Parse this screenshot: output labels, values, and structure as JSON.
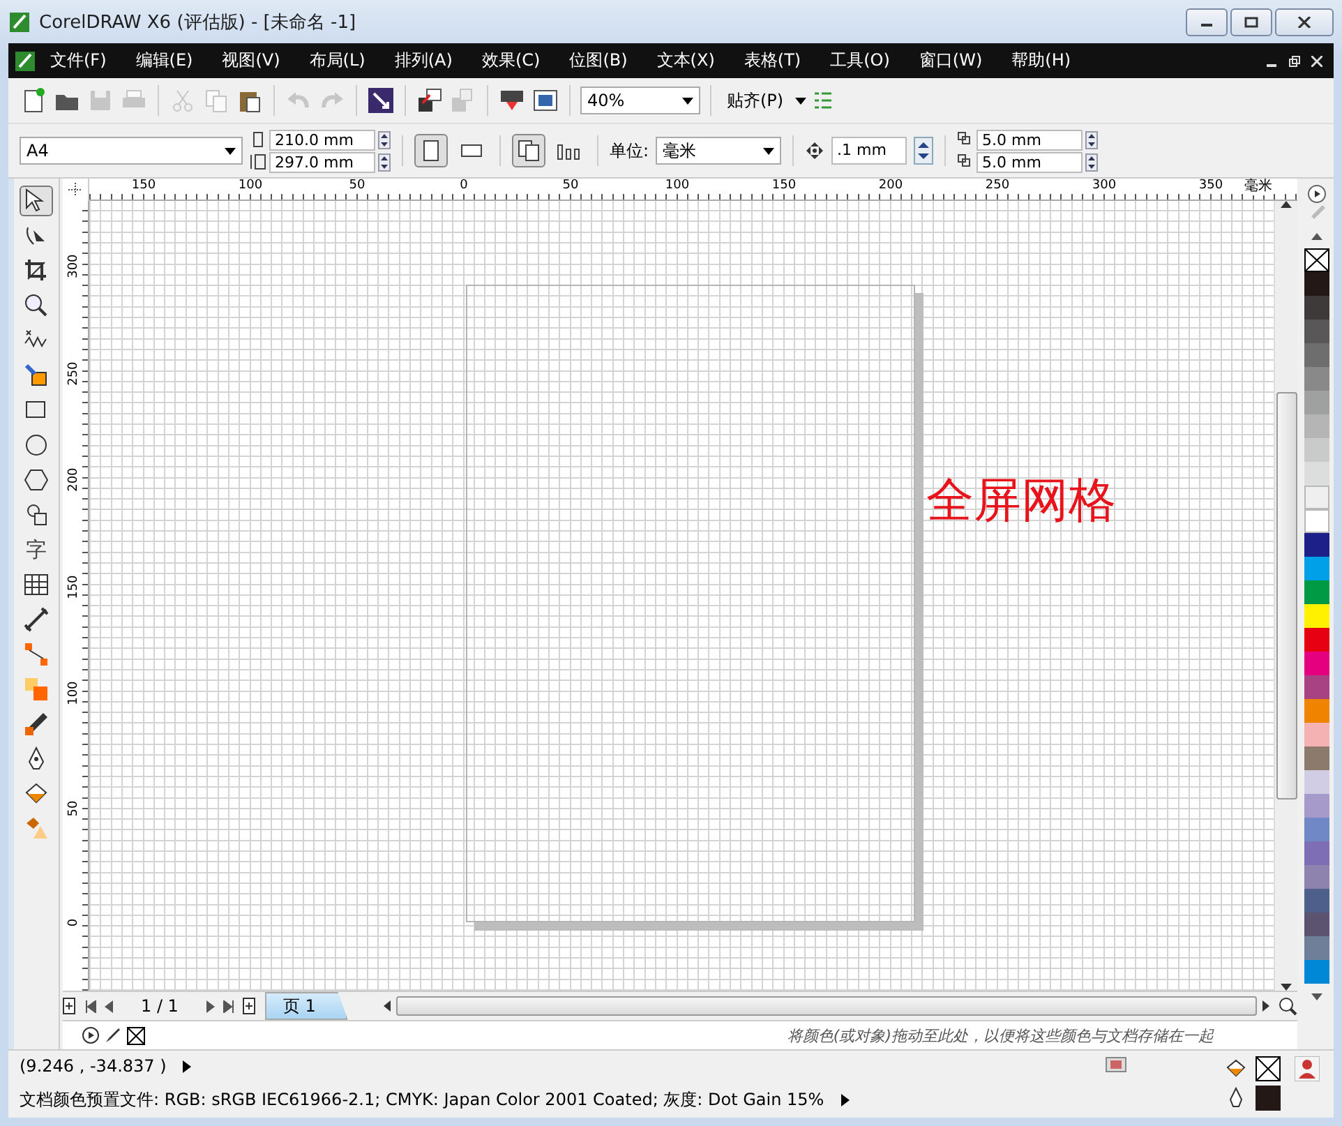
{
  "window": {
    "title": "CorelDRAW X6 (评估版) - [未命名 -1]"
  },
  "menu": [
    "文件(F)",
    "编辑(E)",
    "视图(V)",
    "布局(L)",
    "排列(A)",
    "效果(C)",
    "位图(B)",
    "文本(X)",
    "表格(T)",
    "工具(O)",
    "窗口(W)",
    "帮助(H)"
  ],
  "toolbar": {
    "buttons": [
      {
        "kind": "new",
        "disabled": false
      },
      {
        "kind": "open",
        "disabled": false
      },
      {
        "kind": "save",
        "disabled": true
      },
      {
        "kind": "print",
        "disabled": true
      },
      {
        "kind": "sep"
      },
      {
        "kind": "cut",
        "disabled": true
      },
      {
        "kind": "copy",
        "disabled": true
      },
      {
        "kind": "paste",
        "disabled": false
      },
      {
        "kind": "sep"
      },
      {
        "kind": "undo",
        "disabled": true
      },
      {
        "kind": "redo",
        "disabled": true
      },
      {
        "kind": "sep"
      },
      {
        "kind": "search",
        "disabled": false
      },
      {
        "kind": "sep"
      },
      {
        "kind": "import",
        "disabled": false
      },
      {
        "kind": "export",
        "disabled": true
      },
      {
        "kind": "sep"
      },
      {
        "kind": "publish",
        "disabled": false
      },
      {
        "kind": "launcher",
        "disabled": false
      }
    ],
    "zoom": "40%",
    "snap": "贴齐(P)"
  },
  "property_bar": {
    "page_size": "A4",
    "width": "210.0 mm",
    "height": "297.0 mm",
    "portrait_selected": true,
    "all_pages_selected": true,
    "units_label": "单位:",
    "units": "毫米",
    "nudge": ".1 mm",
    "dup_x": "5.0 mm",
    "dup_y": "5.0 mm"
  },
  "toolbox": [
    {
      "kind": "pick",
      "selected": true
    },
    {
      "kind": "shape",
      "selected": false
    },
    {
      "kind": "crop",
      "selected": false
    },
    {
      "kind": "zoom",
      "selected": false
    },
    {
      "kind": "freehand",
      "selected": false
    },
    {
      "kind": "smartfill",
      "selected": false
    },
    {
      "kind": "rectangle",
      "selected": false
    },
    {
      "kind": "ellipse",
      "selected": false
    },
    {
      "kind": "polygon",
      "selected": false
    },
    {
      "kind": "shapes",
      "selected": false
    },
    {
      "kind": "text",
      "selected": false,
      "text": "字"
    },
    {
      "kind": "table",
      "selected": false
    },
    {
      "kind": "dimension",
      "selected": false
    },
    {
      "kind": "connector",
      "selected": false
    },
    {
      "kind": "blend",
      "selected": false
    },
    {
      "kind": "eyedropper",
      "selected": false
    },
    {
      "kind": "outline",
      "selected": false
    },
    {
      "kind": "fill",
      "selected": false
    },
    {
      "kind": "interactive",
      "selected": false
    }
  ],
  "rulers": {
    "horizontal": [
      "150",
      "100",
      "50",
      "0",
      "50",
      "100",
      "150",
      "200",
      "250",
      "300",
      "350"
    ],
    "unit": "毫米",
    "vertical": [
      "300",
      "250",
      "200",
      "150",
      "100",
      "50",
      "0"
    ]
  },
  "canvas": {
    "annotation": "全屏网格"
  },
  "page_nav": {
    "counter": "1 / 1",
    "tabs": [
      {
        "label": "页 1",
        "selected": true
      }
    ]
  },
  "document_palette": {
    "hint": "将颜色(或对象)拖动至此处，以便将这些颜色与文档存储在一起"
  },
  "palette": [
    {
      "color": "#231815"
    },
    {
      "color": "#3e3a39"
    },
    {
      "color": "#595757"
    },
    {
      "color": "#6f6e6e"
    },
    {
      "color": "#898989"
    },
    {
      "color": "#9fa0a0"
    },
    {
      "color": "#b5b5b6"
    },
    {
      "color": "#c9caca"
    },
    {
      "color": "#dcdddd"
    },
    {
      "color": "#efefef"
    },
    {
      "color": "#ffffff"
    },
    {
      "color": "#1d2088"
    },
    {
      "color": "#00a0e9"
    },
    {
      "color": "#009944"
    },
    {
      "color": "#fff100"
    },
    {
      "color": "#e60012"
    },
    {
      "color": "#e4007f"
    },
    {
      "color": "#a84282"
    },
    {
      "color": "#f08300"
    },
    {
      "color": "#f5b2b2"
    },
    {
      "color": "#8c7a6d"
    },
    {
      "color": "#d1cde5"
    },
    {
      "color": "#a59aca"
    },
    {
      "color": "#7089c6"
    },
    {
      "color": "#7d6eb5"
    },
    {
      "color": "#8e82af"
    },
    {
      "color": "#4e5f8c"
    },
    {
      "color": "#5c5370"
    },
    {
      "color": "#707f99"
    },
    {
      "color": "#0088d6"
    }
  ],
  "status_bar": {
    "coordinates": "(9.246 , -34.837 )",
    "color_profile": "文档颜色预置文件: RGB: sRGB IEC61966-2.1; CMYK: Japan Color 2001 Coated; 灰度: Dot Gain 15%"
  }
}
